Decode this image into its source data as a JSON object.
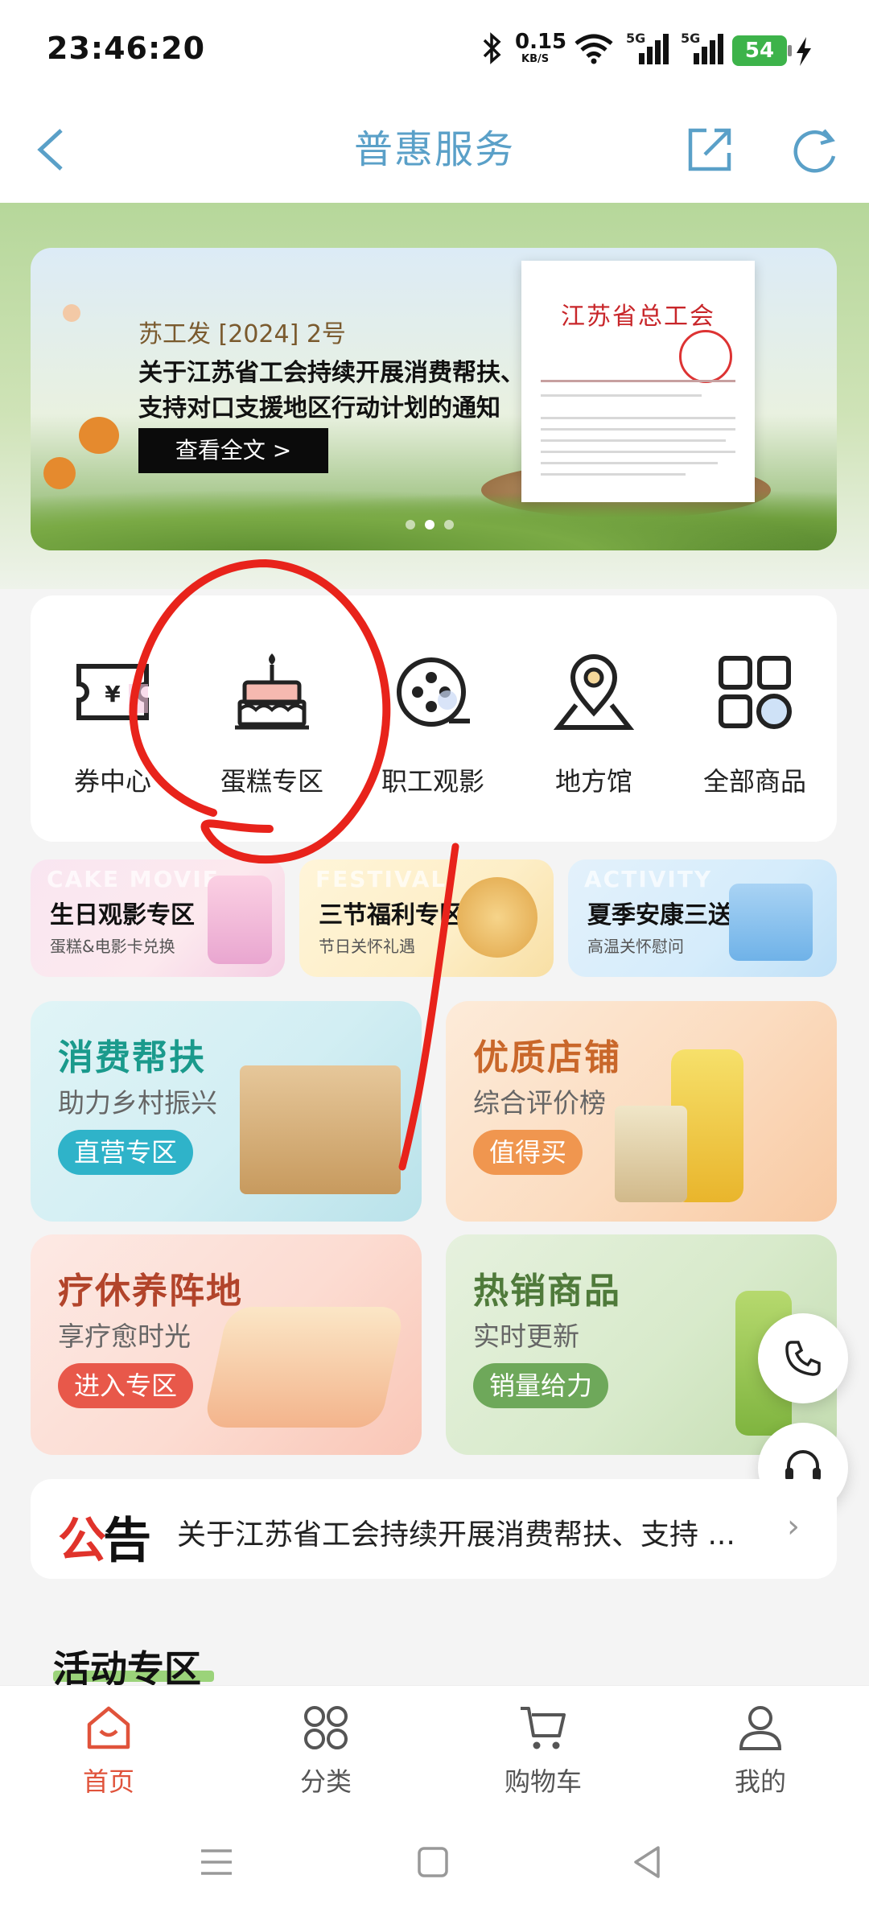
{
  "status_bar": {
    "time": "23:46:20",
    "net_speed_value": "0.15",
    "net_speed_unit": "KB/S",
    "sim1_label": "5G",
    "sim2_label": "5G",
    "battery": "54",
    "icons": [
      "bluetooth-icon",
      "wifi-icon",
      "signal-icon",
      "signal-icon",
      "battery-icon",
      "charging-icon"
    ]
  },
  "nav": {
    "title": "普惠服务",
    "back_icon": "chevron-left-icon",
    "share_icon": "share-icon",
    "refresh_icon": "refresh-icon",
    "accent_color": "#5aa0c8"
  },
  "banner": {
    "doc_code": "苏工发 [2024] 2号",
    "headline_line1": "关于江苏省工会持续开展消费帮扶、",
    "headline_line2": "支持对口支援地区行动计划的通知",
    "button_label": "查看全文 >",
    "paper_title": "江苏省总工会"
  },
  "categories": [
    {
      "label": "券中心",
      "icon": "coupon-icon"
    },
    {
      "label": "蛋糕专区",
      "icon": "cake-icon"
    },
    {
      "label": "职工观影",
      "icon": "film-reel-icon"
    },
    {
      "label": "地方馆",
      "icon": "location-pin-icon"
    },
    {
      "label": "全部商品",
      "icon": "grid-icon"
    }
  ],
  "promos": [
    {
      "bg_text": "CAKE MOVIE",
      "title": "生日观影专区",
      "subtitle": "蛋糕&电影卡兑换"
    },
    {
      "bg_text": "FESTIVAL",
      "title": "三节福利专区",
      "subtitle": "节日关怀礼遇"
    },
    {
      "bg_text": "ACTIVITY",
      "title": "夏季安康三送",
      "subtitle": "高温关怀慰问"
    }
  ],
  "big_cards": [
    {
      "title": "消费帮扶",
      "subtitle": "助力乡村振兴",
      "button": "直营专区",
      "title_color": "#1a9a8c",
      "button_color": "#2fb3c9"
    },
    {
      "title": "优质店铺",
      "subtitle": "综合评价榜",
      "button": "值得买",
      "title_color": "#c9672a",
      "button_color": "#f0964f"
    },
    {
      "title": "疗休养阵地",
      "subtitle": "享疗愈时光",
      "button": "进入专区",
      "title_color": "#b2442b",
      "button_color": "#e8584a"
    },
    {
      "title": "热销商品",
      "subtitle": "实时更新",
      "button": "销量给力",
      "title_color": "#4f7a3a",
      "button_color": "#6ea85a"
    }
  ],
  "notice": {
    "badge_red": "公",
    "badge_black": "告",
    "text": "关于江苏省工会持续开展消费帮扶、支持 ...",
    "arrow": "›"
  },
  "activity": {
    "title": "活动专区"
  },
  "floating": [
    {
      "icon": "phone-icon"
    },
    {
      "icon": "headset-icon"
    }
  ],
  "tabs": [
    {
      "label": "首页",
      "icon": "home-icon",
      "active": true
    },
    {
      "label": "分类",
      "icon": "category-icon",
      "active": false
    },
    {
      "label": "购物车",
      "icon": "cart-icon",
      "active": false
    },
    {
      "label": "我的",
      "icon": "user-icon",
      "active": false
    }
  ],
  "tab_active_color": "#e0533b",
  "annotation_color": "#e8231b"
}
